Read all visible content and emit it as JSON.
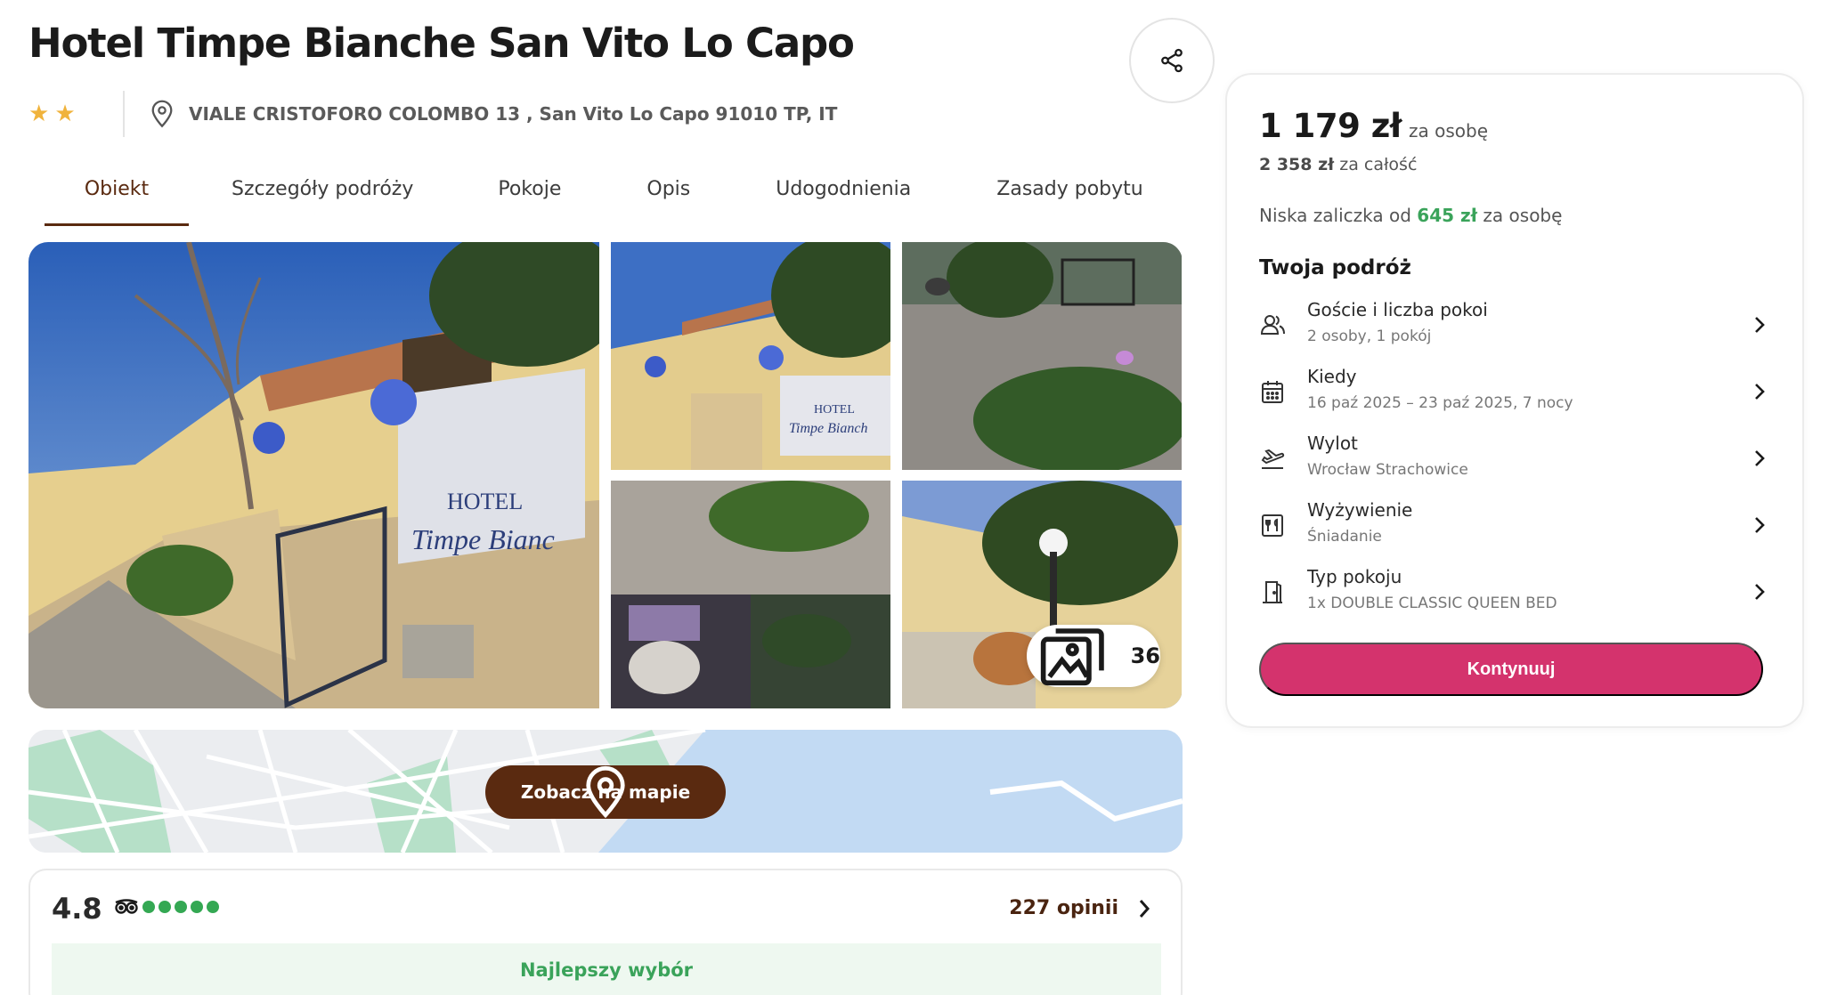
{
  "hotel": {
    "title": "Hotel Timpe Bianche San Vito Lo Capo",
    "stars": 2,
    "address": "VIALE CRISTOFORO COLOMBO 13 , San Vito Lo Capo 91010 TP, IT"
  },
  "icons": {
    "share": "share-icon",
    "star": "star-icon",
    "location": "location-pin-icon",
    "gallery": "gallery-icon",
    "tripadvisor": "tripadvisor-icon",
    "chevron": "chevron-right-icon",
    "guests": "people-icon",
    "dates": "calendar-icon",
    "departure": "plane-departure-icon",
    "board": "restaurant-menu-icon",
    "room": "door-icon"
  },
  "tabs": [
    {
      "label": "Obiekt",
      "active": true
    },
    {
      "label": "Szczegóły podróży",
      "active": false
    },
    {
      "label": "Pokoje",
      "active": false
    },
    {
      "label": "Opis",
      "active": false
    },
    {
      "label": "Udogodnienia",
      "active": false
    },
    {
      "label": "Zasady pobytu",
      "active": false
    }
  ],
  "gallery": {
    "photo_count": "36"
  },
  "map": {
    "button_label": "Zobacz na mapie"
  },
  "reviews": {
    "rating": "4.8",
    "tripadvisor_bubbles": 5,
    "count_label": "227 opinii",
    "badge": "Najlepszy wybór"
  },
  "booking": {
    "price": "1 179 zł",
    "price_unit": "za osobę",
    "total_amount": "2 358 zł",
    "total_suffix": "za całość",
    "deposit_prefix": "Niska zaliczka od",
    "deposit_amount": "645 zł",
    "deposit_suffix": "za osobę",
    "trip_title": "Twoja podróż",
    "items": [
      {
        "label": "Goście i liczba pokoi",
        "value": "2 osoby, 1 pokój"
      },
      {
        "label": "Kiedy",
        "value": "16 paź 2025 – 23 paź 2025, 7 nocy"
      },
      {
        "label": "Wylot",
        "value": "Wrocław Strachowice"
      },
      {
        "label": "Wyżywienie",
        "value": "Śniadanie"
      },
      {
        "label": "Typ pokoju",
        "value": "1x DOUBLE CLASSIC QUEEN BED"
      }
    ],
    "continue_label": "Kontynuuj"
  },
  "colors": {
    "accent_brown": "#5a2a10",
    "cta_pink": "#d4336d",
    "green": "#3aa35a",
    "star": "#f0b33c"
  }
}
